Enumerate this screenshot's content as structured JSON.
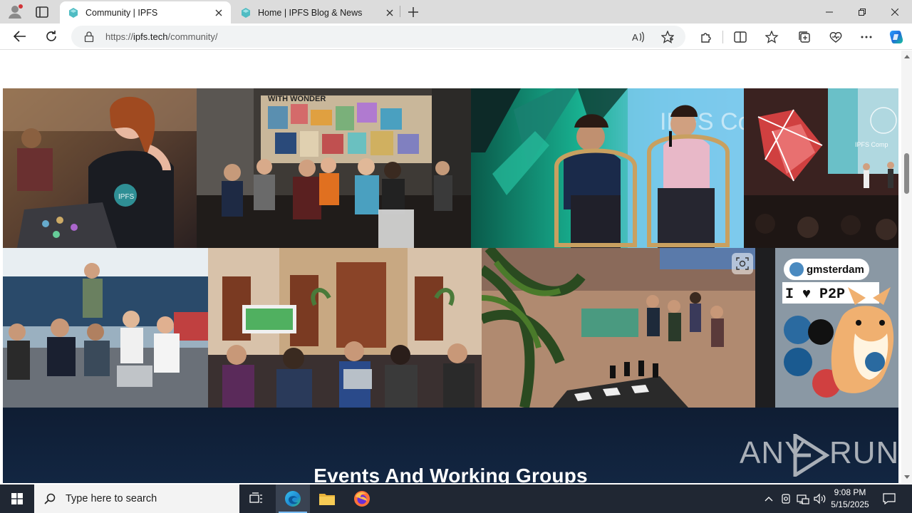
{
  "browser": {
    "tabs": [
      {
        "title": "Community | IPFS",
        "active": true
      },
      {
        "title": "Home | IPFS Blog & News",
        "active": false
      }
    ],
    "address": {
      "scheme": "https://",
      "host": "ipfs.tech",
      "path": "/community/"
    }
  },
  "page": {
    "section_heading": "Events And Working Groups",
    "photos_row1": [
      {
        "alt": "Woman in IPFS shirt smiling at laptop"
      },
      {
        "alt": "People seated at tables under art wall"
      },
      {
        "alt": "Two speakers in wicker chairs on stage"
      },
      {
        "alt": "Stage with geometric art at IPFS Camp"
      }
    ],
    "photos_row2": [
      {
        "alt": "Group gathered on outdoor couches"
      },
      {
        "alt": "Audience watching presentation in ornate hall"
      },
      {
        "alt": "Crowded courtyard with giant chess board"
      },
      {
        "alt": "Laptop with gmsterdam I love P2P stickers and plush toy"
      }
    ],
    "photo_text": {
      "wall_sign": "WITH WONDER",
      "stage_sign": "IPFS Comp",
      "sticker": "gmsterdam",
      "sticker_line2": "I ♥ P2P",
      "shirt": "IPFS"
    }
  },
  "watermark": {
    "left": "ANY",
    "right": "RUN"
  },
  "taskbar": {
    "search_placeholder": "Type here to search",
    "time": "9:08 PM",
    "date": "5/15/2025"
  },
  "colors": {
    "events_bg": "#0f1d33",
    "tab_active": "#ffffff",
    "tabstrip": "#dcdcdc",
    "taskbar": "#202733"
  }
}
